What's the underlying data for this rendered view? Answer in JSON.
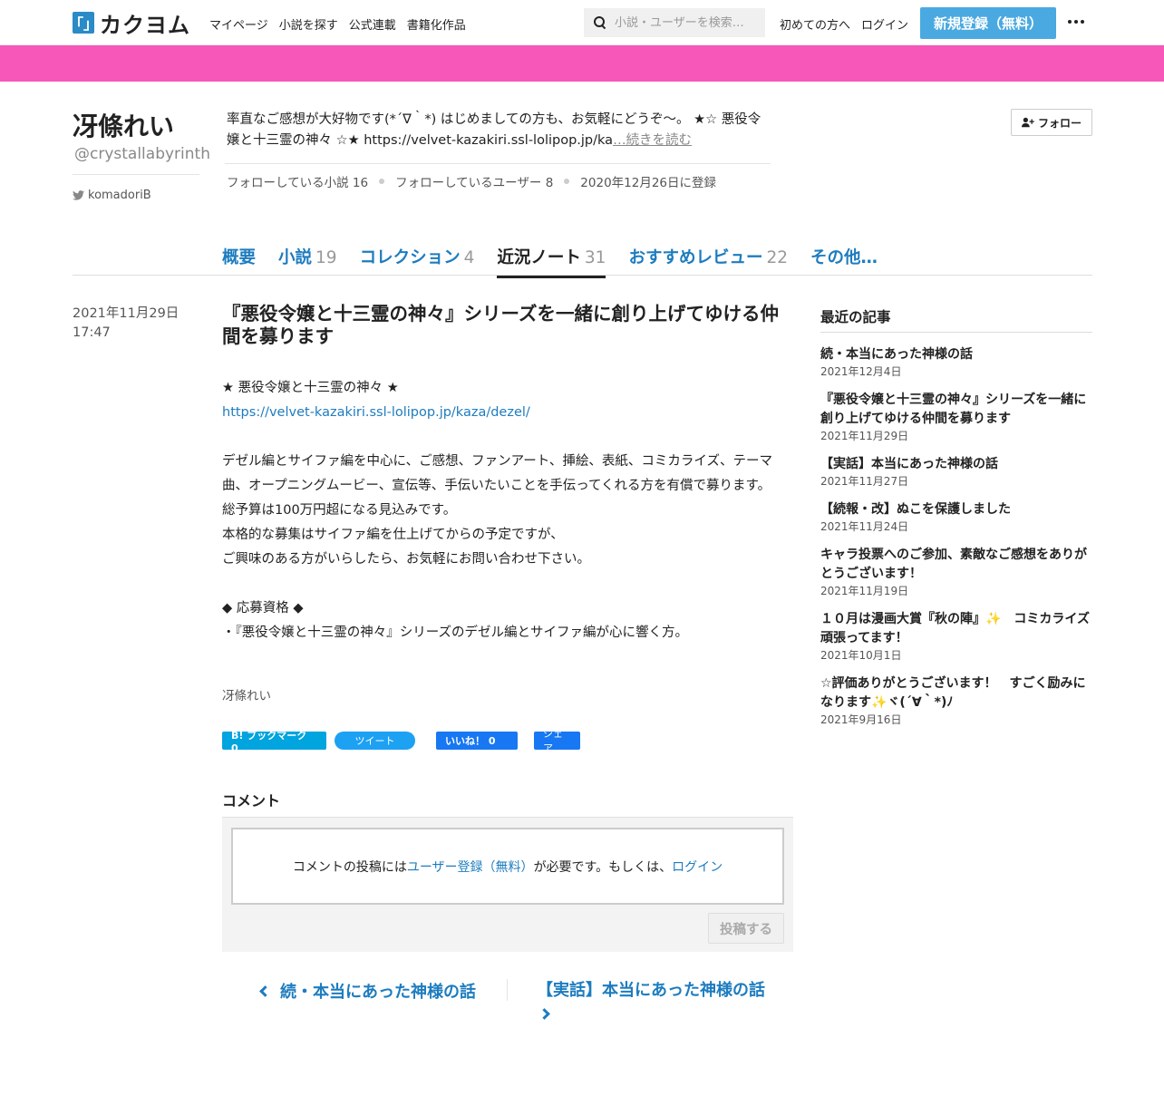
{
  "header": {
    "logo_mark": "「」",
    "logo_text": "カクヨム",
    "nav": [
      "マイページ",
      "小説を探す",
      "公式連載",
      "書籍化作品"
    ],
    "search_placeholder": "小説・ユーザーを検索…",
    "first_time": "初めての方へ",
    "login": "ログイン",
    "register": "新規登録（無料）"
  },
  "colors": {
    "banner": "#f657b9",
    "accent": "#1d7cbf",
    "register": "#4aa9e0"
  },
  "profile": {
    "name": "冴條れい",
    "handle": "@crystallabyrinth",
    "twitter": "komadoriB",
    "intro": "率直なご感想が大好物です(*´∇｀*) はじめましての方も、お気軽にどうぞ～。 ★☆ 悪役令嬢と十三霊の神々 ☆★ https://velvet-kazakiri.ssl-lolipop.jp/ka",
    "read_more": "…続きを読む",
    "follow": "フォロー",
    "stats": {
      "following_novels": "フォローしている小説 16",
      "following_users": "フォローしているユーザー 8",
      "registered": "2020年12月26日に登録"
    }
  },
  "tabs": [
    {
      "label": "概要",
      "count": ""
    },
    {
      "label": "小説",
      "count": "19"
    },
    {
      "label": "コレクション",
      "count": "4"
    },
    {
      "label": "近況ノート",
      "count": "31"
    },
    {
      "label": "おすすめレビュー",
      "count": "22"
    },
    {
      "label": "その他…",
      "count": ""
    }
  ],
  "article": {
    "date": "2021年11月29日",
    "time": "17:47",
    "title": "『悪役令嬢と十三霊の神々』シリーズを一緒に創り上げてゆける仲間を募ります",
    "body": {
      "l1": "★ 悪役令嬢と十三霊の神々 ★",
      "link": "https://velvet-kazakiri.ssl-lolipop.jp/kaza/dezel/",
      "l3": "デゼル編とサイファ編を中心に、ご感想、ファンアート、挿絵、表紙、コミカライズ、テーマ曲、オープニングムービー、宣伝等、手伝いたいことを手伝ってくれる方を有償で募ります。",
      "l4": "総予算は100万円超になる見込みです。",
      "l5": "本格的な募集はサイファ編を仕上げてからの予定ですが、",
      "l6": "ご興味のある方がいらしたら、お気軽にお問い合わせ下さい。",
      "l7": "◆ 応募資格 ◆",
      "l8": "・『悪役令嬢と十三霊の神々』シリーズのデゼル編とサイファ編が心に響く方。"
    },
    "author": "冴條れい"
  },
  "share": {
    "bookmark": "B! ブックマーク　0",
    "tweet": "ツイート",
    "like": "いいね！ 0",
    "share": "シェア"
  },
  "comments": {
    "title": "コメント",
    "pre": "コメントの投稿には",
    "register_link": "ユーザー登録（無料）",
    "mid": "が必要です。もしくは、",
    "login_link": "ログイン",
    "post": "投稿する"
  },
  "pager": {
    "prev": "続・本当にあった神様の話",
    "next": "【実話】本当にあった神様の話"
  },
  "sidebar": {
    "title": "最近の記事",
    "items": [
      {
        "title": "続・本当にあった神様の話",
        "date": "2021年12月4日"
      },
      {
        "title": "『悪役令嬢と十三霊の神々』シリーズを一緒に創り上げてゆける仲間を募ります",
        "date": "2021年11月29日"
      },
      {
        "title": "【実話】本当にあった神様の話",
        "date": "2021年11月27日"
      },
      {
        "title": "【続報・改】ぬこを保護しました",
        "date": "2021年11月24日"
      },
      {
        "title": "キャラ投票へのご参加、素敵なご感想をありがとうございます！",
        "date": "2021年11月19日"
      },
      {
        "title": "１０月は漫画大賞『秋の陣』✨　コミカライズ頑張ってます！",
        "date": "2021年10月1日"
      },
      {
        "title": "☆評価ありがとうございます！　すごく励みになります✨ヾ(´∀｀*)ﾉ",
        "date": "2021年9月16日"
      }
    ]
  }
}
